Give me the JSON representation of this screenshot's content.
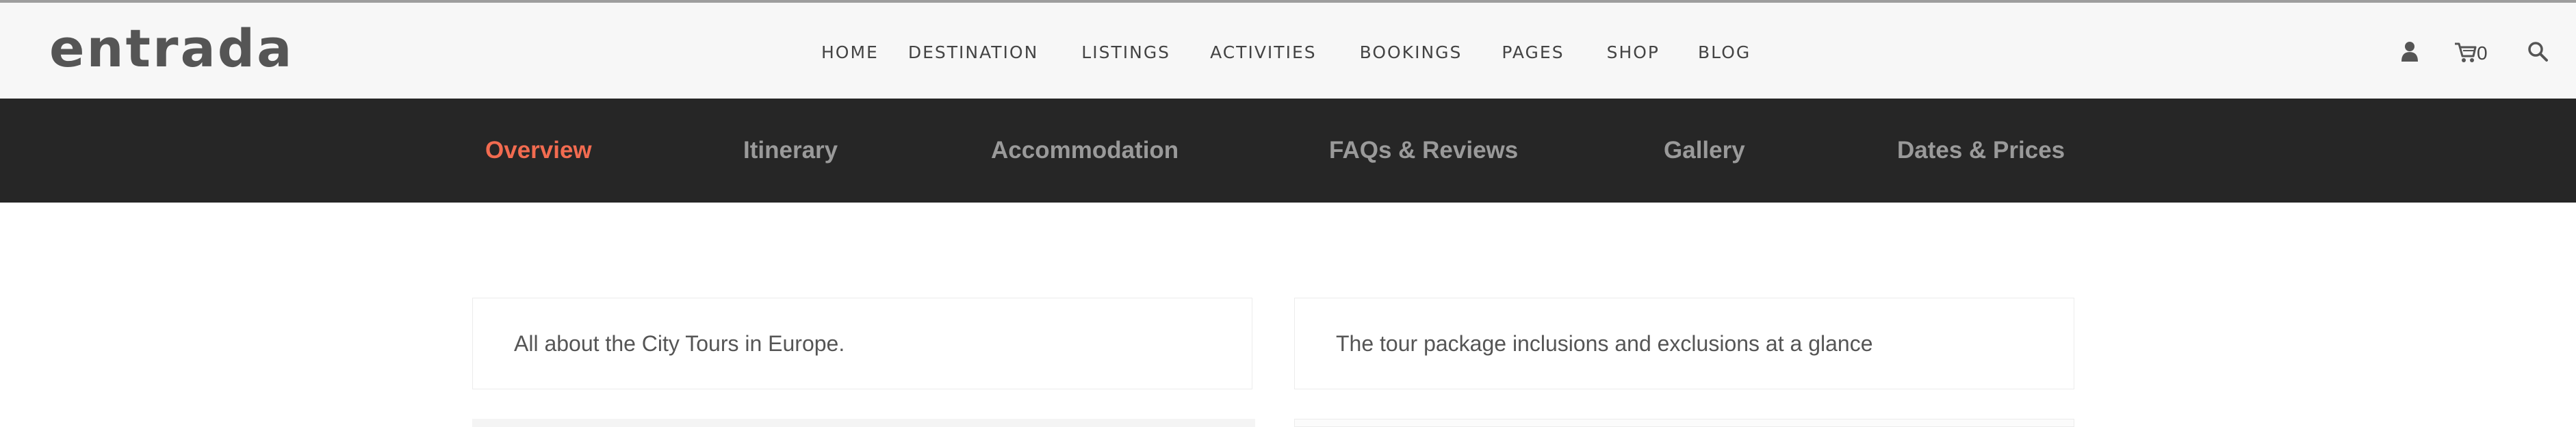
{
  "brand": {
    "logo_text": "entrada"
  },
  "main_nav": {
    "items": [
      {
        "label": "HOME"
      },
      {
        "label": "DESTINATION"
      },
      {
        "label": "LISTINGS"
      },
      {
        "label": "ACTIVITIES"
      },
      {
        "label": "BOOKINGS"
      },
      {
        "label": "PAGES"
      },
      {
        "label": "SHOP"
      },
      {
        "label": "BLOG"
      }
    ]
  },
  "header_icons": {
    "account": "user-icon",
    "cart": "cart-icon",
    "cart_count": "0",
    "search": "search-icon"
  },
  "sub_nav": {
    "items": [
      {
        "label": "Overview",
        "active": true
      },
      {
        "label": "Itinerary"
      },
      {
        "label": "Accommodation"
      },
      {
        "label": "FAQs & Reviews"
      },
      {
        "label": "Gallery"
      },
      {
        "label": "Dates & Prices"
      }
    ]
  },
  "cards": [
    {
      "text": "All about the City Tours in Europe."
    },
    {
      "text": "The tour package inclusions and exclusions at a glance"
    }
  ],
  "colors": {
    "accent": "#f26b50",
    "subnav_bg": "#262626",
    "header_bg": "#f7f7f7"
  }
}
